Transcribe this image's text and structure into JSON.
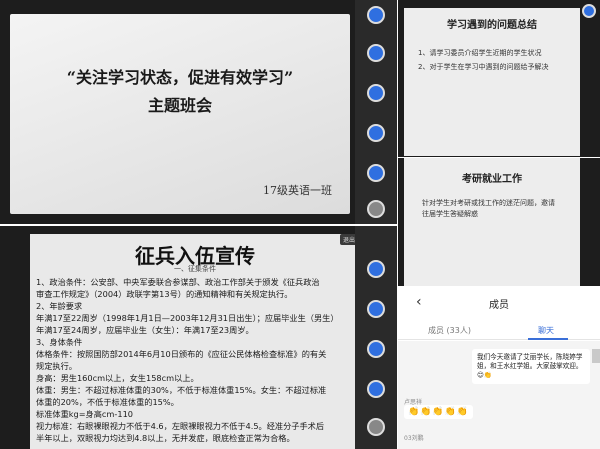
{
  "p1": {
    "title_line1": "“关注学习状态，促进有效学习”",
    "title_line2": "主题班会",
    "class_label": "17级英语一班"
  },
  "p2": {
    "title": "学习遇到的问题总结",
    "lines": [
      "1、请学习委员介绍学生近期的学生状况",
      "2、对于学生在学习中遇到的问题给予解决"
    ]
  },
  "p3": {
    "title": "考研就业工作",
    "lines": [
      "针对学生对考研或找工作的迷茫问题，邀请",
      "往届学生答疑解惑"
    ]
  },
  "p4": {
    "title": "征兵入伍宣传",
    "subtitle": "一、征集条件",
    "lines": [
      "1、政治条件：公安部、中央军委联合参谋部、政治工作部关于颁发《征兵政治",
      "审查工作规定》（2004）政联字第13号）的通知精神和有关规定执行。",
      "2、年龄要求",
      "年满17至22周岁（1998年1月1日—2003年12月31日出生）；应届毕业生（男生）",
      "年满17至24周岁，应届毕业生（女生）：年满17至23周岁。",
      "3、身体条件",
      "体格条件：按照国防部2014年6月10日颁布的《应征公民体格检查标准》的有关",
      "规定执行。",
      "身高：男生160cm以上，女生158cm以上。",
      "体重：男生：不超过标准体重的30%，不低于标准体重15%。女生：不超过标准",
      "体重的20%，不低于标准体重的15%。",
      "标准体重kg=身高cm-110",
      "视力标准：右眼裸眼视力不低于4.6，左眼裸眼视力不低于4.5。经准分子手术后",
      "半年以上，双眼视力均达到4.8以上，无并发症，眼底检查正常为合格。"
    ],
    "button": "退出共享"
  },
  "chat": {
    "back": "‹",
    "title": "成员",
    "tab_members": "成员 (33人)",
    "tab_chat": "聊天",
    "message": "我们今天邀请了艾丽学长，陈晓婷学姐，和王水红学姐。大家鼓掌欢迎。😊👏",
    "sender": "卢思祥",
    "clap": "👏👏👏👏👏",
    "sender2": "03刘鹏"
  }
}
